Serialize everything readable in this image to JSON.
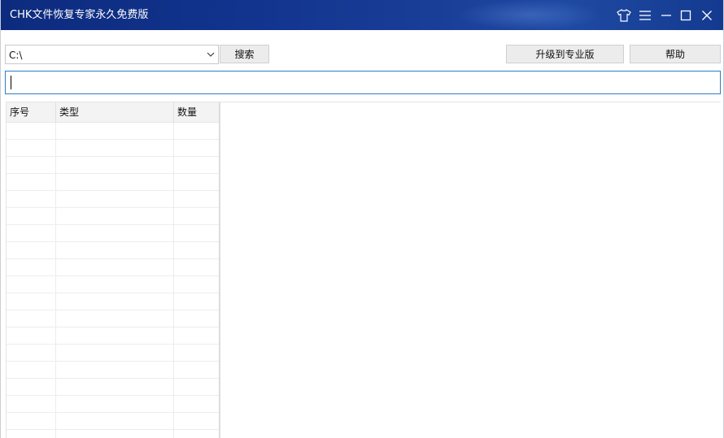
{
  "window": {
    "title": "CHK文件恢复专家永久免费版"
  },
  "titlebar_icons": {
    "skin": "shirt-icon",
    "menu": "menu-icon",
    "minimize": "minimize-icon",
    "maximize": "maximize-icon",
    "close": "close-icon"
  },
  "toolbar": {
    "drive_value": "C:\\",
    "search_label": "搜索",
    "upgrade_label": "升级到专业版",
    "help_label": "帮助"
  },
  "input": {
    "value": ""
  },
  "table": {
    "columns": [
      "序号",
      "类型",
      "数量"
    ],
    "rows": [
      [
        "",
        "",
        ""
      ],
      [
        "",
        "",
        ""
      ],
      [
        "",
        "",
        ""
      ],
      [
        "",
        "",
        ""
      ],
      [
        "",
        "",
        ""
      ],
      [
        "",
        "",
        ""
      ],
      [
        "",
        "",
        ""
      ],
      [
        "",
        "",
        ""
      ],
      [
        "",
        "",
        ""
      ],
      [
        "",
        "",
        ""
      ],
      [
        "",
        "",
        ""
      ],
      [
        "",
        "",
        ""
      ],
      [
        "",
        "",
        ""
      ],
      [
        "",
        "",
        ""
      ],
      [
        "",
        "",
        ""
      ],
      [
        "",
        "",
        ""
      ],
      [
        "",
        "",
        ""
      ],
      [
        "",
        "",
        ""
      ],
      [
        "",
        "",
        ""
      ]
    ]
  },
  "colors": {
    "titlebar": "#12348e",
    "input_focus_border": "#2b7fc5",
    "button_bg": "#ececec"
  }
}
